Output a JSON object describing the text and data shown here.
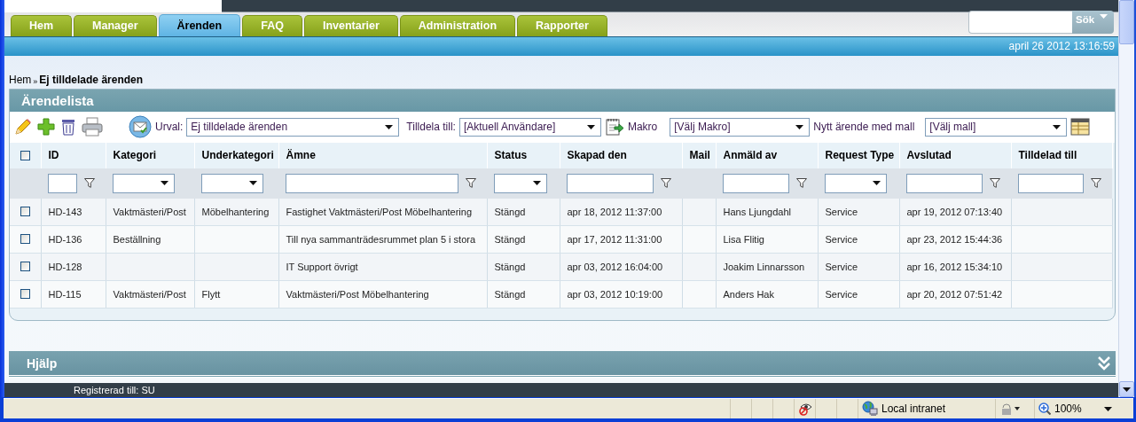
{
  "tabs": [
    {
      "label": "Hem",
      "selected": false
    },
    {
      "label": "Manager",
      "selected": false
    },
    {
      "label": "Ärenden",
      "selected": true
    },
    {
      "label": "FAQ",
      "selected": false
    },
    {
      "label": "Inventarier",
      "selected": false
    },
    {
      "label": "Administration",
      "selected": false
    },
    {
      "label": "Rapporter",
      "selected": false
    }
  ],
  "search": {
    "button": "Sök"
  },
  "date": "april 26 2012 13:16:59",
  "breadcrumb": {
    "home": "Hem",
    "separator": "»",
    "current": "Ej tilldelade ärenden"
  },
  "panel": {
    "title": "Ärendelista"
  },
  "toolbar": {
    "urval_label": "Urval:",
    "urval_value": "Ej tilldelade ärenden",
    "assign_label": "Tilldela till:",
    "assign_value": "[Aktuell Användare]",
    "macro_label": "Makro",
    "macro_value": "[Välj Makro]",
    "template_label": "Nytt ärende med mall",
    "template_value": "[Välj mall]"
  },
  "table": {
    "all_checked": false,
    "columns": [
      {
        "label": "ID",
        "kind": "text"
      },
      {
        "label": "Kategori",
        "kind": "select"
      },
      {
        "label": "Underkategori",
        "kind": "select"
      },
      {
        "label": "Ämne",
        "kind": "text"
      },
      {
        "label": "Status",
        "kind": "select"
      },
      {
        "label": "Skapad den",
        "kind": "text"
      },
      {
        "label": "Mail",
        "kind": "plain"
      },
      {
        "label": "Anmäld av",
        "kind": "text"
      },
      {
        "label": "Request Type",
        "kind": "select"
      },
      {
        "label": "Avslutad",
        "kind": "text"
      },
      {
        "label": "Tilldelad till",
        "kind": "text"
      }
    ],
    "rows": [
      {
        "checked": false,
        "cells": [
          "HD-143",
          "Vaktmästeri/Post",
          "Möbelhantering",
          "Fastighet Vaktmästeri/Post Möbelhantering",
          "Stängd",
          "apr 18, 2012 11:37:00",
          "",
          "Hans Ljungdahl",
          "Service",
          "apr 19, 2012 07:13:40",
          ""
        ]
      },
      {
        "checked": false,
        "cells": [
          "HD-136",
          "Beställning",
          "",
          "Till nya sammanträdesrummet plan 5 i stora",
          "Stängd",
          "apr 17, 2012 11:31:00",
          "",
          "Lisa Flitig",
          "Service",
          "apr 23, 2012 15:44:36",
          ""
        ]
      },
      {
        "checked": false,
        "cells": [
          "HD-128",
          "",
          "",
          "IT Support övrigt",
          "Stängd",
          "apr 03, 2012 16:04:00",
          "",
          "Joakim Linnarsson",
          "Service",
          "apr 16, 2012 15:34:10",
          ""
        ]
      },
      {
        "checked": false,
        "cells": [
          "HD-115",
          "Vaktmästeri/Post",
          "Flytt",
          "Vaktmästeri/Post Möbelhantering",
          "Stängd",
          "apr 03, 2012 10:19:00",
          "",
          "Anders Hak",
          "Service",
          "apr 20, 2012 07:51:42",
          ""
        ]
      }
    ]
  },
  "help": {
    "title": "Hjälp"
  },
  "footer": "Registrerad till: SU",
  "status_bar": {
    "zone": "Local intranet",
    "zoom": "100%"
  }
}
